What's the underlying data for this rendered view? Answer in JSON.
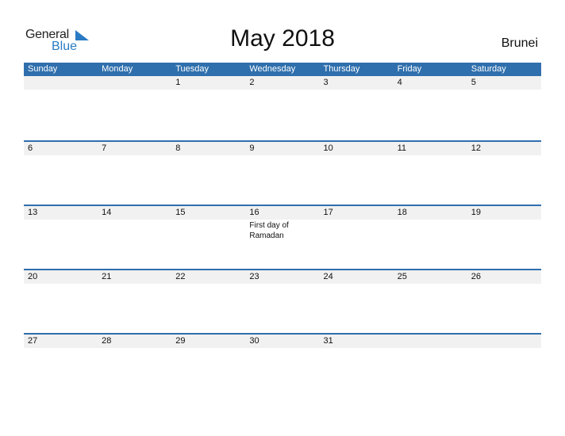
{
  "logo": {
    "general": "General",
    "blue": "Blue"
  },
  "title": "May 2018",
  "country": "Brunei",
  "colors": {
    "header_bg": "#2f6fad",
    "date_strip_bg": "#f1f1f1",
    "logo_blue": "#2a7bc4"
  },
  "weekdays": [
    "Sunday",
    "Monday",
    "Tuesday",
    "Wednesday",
    "Thursday",
    "Friday",
    "Saturday"
  ],
  "weeks": [
    {
      "days": [
        "",
        "",
        "1",
        "2",
        "3",
        "4",
        "5"
      ],
      "events": [
        "",
        "",
        "",
        "",
        "",
        "",
        ""
      ]
    },
    {
      "days": [
        "6",
        "7",
        "8",
        "9",
        "10",
        "11",
        "12"
      ],
      "events": [
        "",
        "",
        "",
        "",
        "",
        "",
        ""
      ]
    },
    {
      "days": [
        "13",
        "14",
        "15",
        "16",
        "17",
        "18",
        "19"
      ],
      "events": [
        "",
        "",
        "",
        "First day of Ramadan",
        "",
        "",
        ""
      ]
    },
    {
      "days": [
        "20",
        "21",
        "22",
        "23",
        "24",
        "25",
        "26"
      ],
      "events": [
        "",
        "",
        "",
        "",
        "",
        "",
        ""
      ]
    },
    {
      "days": [
        "27",
        "28",
        "29",
        "30",
        "31",
        "",
        ""
      ],
      "events": [
        "",
        "",
        "",
        "",
        "",
        "",
        ""
      ]
    }
  ]
}
